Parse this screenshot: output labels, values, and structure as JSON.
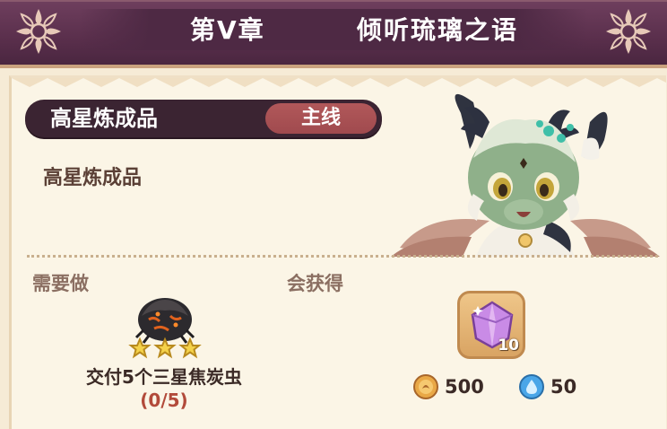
{
  "header": {
    "chapter": "第V章",
    "subtitle": "倾听琉璃之语"
  },
  "quest": {
    "name": "高星炼成品",
    "tag": "主线",
    "description": "高星炼成品"
  },
  "requirements": {
    "label": "需要做",
    "item_icon": "charcoal-beetle-icon",
    "stars": 3,
    "text": "交付5个三星焦炭虫",
    "progress": "(0/5)"
  },
  "rewards": {
    "label": "会获得",
    "item": {
      "icon": "purple-crystal-icon",
      "quantity": "10"
    },
    "coin": {
      "icon": "gold-coin-icon",
      "value": "500"
    },
    "water": {
      "icon": "water-drop-icon",
      "value": "50"
    }
  },
  "colors": {
    "header": "#5a2f4c",
    "pill": "#3b2432",
    "tag": "#a04a4e",
    "background": "#fbf5e6"
  }
}
